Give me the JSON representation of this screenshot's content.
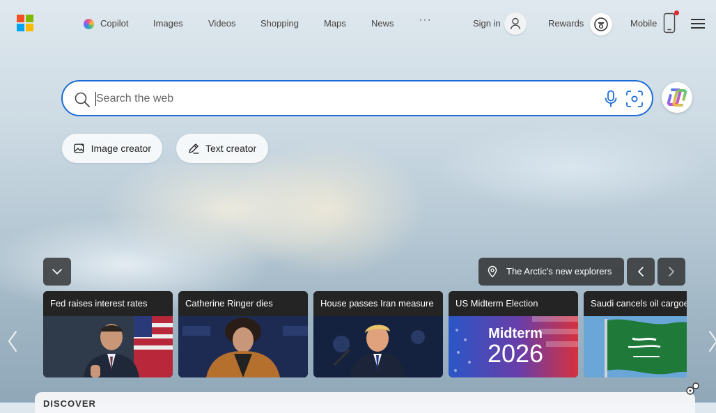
{
  "header": {
    "nav": [
      {
        "id": "copilot",
        "label": "Copilot"
      },
      {
        "id": "images",
        "label": "Images"
      },
      {
        "id": "videos",
        "label": "Videos"
      },
      {
        "id": "shopping",
        "label": "Shopping"
      },
      {
        "id": "maps",
        "label": "Maps"
      },
      {
        "id": "news",
        "label": "News"
      }
    ],
    "more": "···",
    "sign_in": "Sign in",
    "rewards": "Rewards",
    "mobile": "Mobile"
  },
  "search": {
    "placeholder": "Search the web",
    "value": ""
  },
  "chips": [
    {
      "label": "Image creator",
      "icon": "image-creator-icon"
    },
    {
      "label": "Text creator",
      "icon": "pen-icon"
    }
  ],
  "story": {
    "label": "The Arctic's new explorers",
    "icon": "location-pin-icon"
  },
  "news_cards": [
    {
      "title": "Fed raises interest rates"
    },
    {
      "title": "Catherine Ringer dies"
    },
    {
      "title": "House passes Iran measure"
    },
    {
      "title": "US Midterm Election",
      "image_text_1": "Midterm",
      "image_text_2": "2026"
    },
    {
      "title": "Saudi cancels oil cargoes"
    }
  ],
  "discover": {
    "label": "DISCOVER"
  },
  "colors": {
    "accent": "#1b6bd6",
    "ms_red": "#f25022",
    "ms_green": "#7fba00",
    "ms_blue": "#00a4ef",
    "ms_yellow": "#ffb900",
    "notification": "#e3262e"
  }
}
